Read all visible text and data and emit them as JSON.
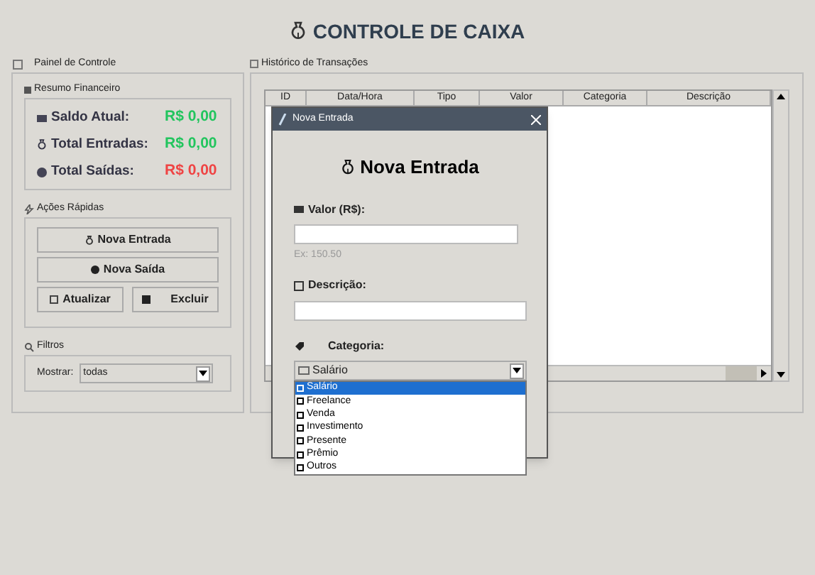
{
  "title": "CONTROLE DE CAIXA",
  "control_panel": {
    "title": "Painel de Controle",
    "summary": {
      "title": "Resumo Financeiro",
      "rows": [
        {
          "label": "Saldo Atual:",
          "value": "R$ 0,00",
          "color": "#22c55e"
        },
        {
          "label": "Total Entradas:",
          "value": "R$ 0,00",
          "color": "#22c55e"
        },
        {
          "label": "Total Saídas:",
          "value": "R$ 0,00",
          "color": "#ef4444"
        }
      ]
    },
    "quick_actions": {
      "title": "Ações Rápidas",
      "buttons": [
        "Nova Entrada",
        "Nova Saída",
        "Atualizar",
        "Excluir"
      ]
    },
    "filters": {
      "title": "Filtros",
      "label": "Mostrar:",
      "value": "todas"
    }
  },
  "history": {
    "title": "Histórico de Transações",
    "table": {
      "columns": [
        "ID",
        "Data/Hora",
        "Tipo",
        "Valor",
        "Categoria",
        "Descrição"
      ]
    }
  },
  "dialog": {
    "title": "Nova Entrada",
    "heading": "Nova Entrada",
    "value_field": {
      "label": "Valor (R$):",
      "hint": "Ex: 150.50"
    },
    "description_field": {
      "label": "Descrição:"
    },
    "category": {
      "label": "Categoria:",
      "value": "Salário",
      "options": [
        {
          "label": "Salário",
          "selected": true
        },
        {
          "label": "Freelance",
          "selected": false
        },
        {
          "label": "Venda",
          "selected": false
        },
        {
          "label": "Investimento",
          "selected": false
        },
        {
          "label": "Presente",
          "selected": false
        },
        {
          "label": "Prêmio",
          "selected": false
        },
        {
          "label": "Outros",
          "selected": false
        }
      ]
    }
  }
}
